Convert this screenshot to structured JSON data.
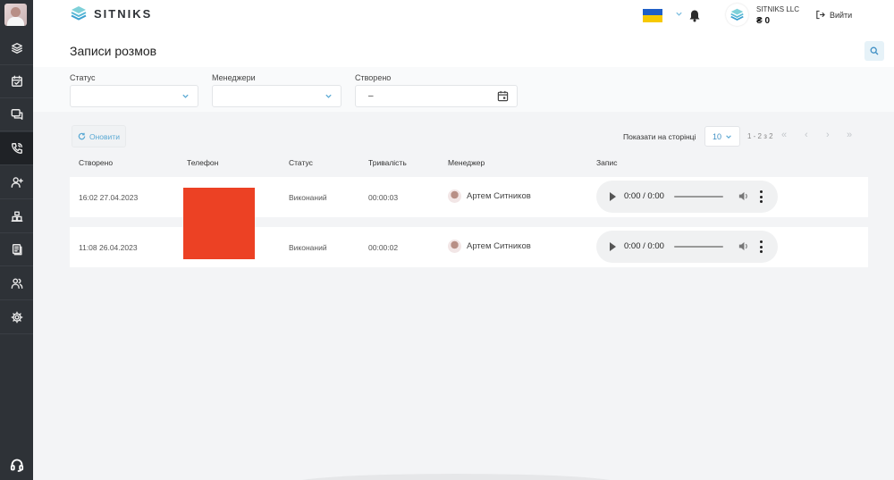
{
  "app": {
    "brand": "SITNIKS",
    "company": "SITNIKS LLC",
    "balance": "₴ 0",
    "logout_label": "Вийти",
    "accent": "#5aa9d4"
  },
  "sidebar": {
    "items": [
      {
        "icon": "layers-icon"
      },
      {
        "icon": "calendar-icon"
      },
      {
        "icon": "chat-icon"
      },
      {
        "icon": "phone-icon",
        "active": true
      },
      {
        "icon": "add-user-icon"
      },
      {
        "icon": "warehouse-icon"
      },
      {
        "icon": "documents-icon"
      },
      {
        "icon": "users-icon"
      },
      {
        "icon": "settings-icon"
      }
    ],
    "bottom_icon": "support-headset-icon"
  },
  "page": {
    "title": "Записи розмов"
  },
  "filters": {
    "status_label": "Статус",
    "status_value": "",
    "managers_label": "Менеджери",
    "managers_value": "",
    "created_label": "Створено",
    "created_value": "–"
  },
  "toolbar": {
    "refresh_label": "Оновити",
    "per_page_label": "Показати на сторінці",
    "per_page_value": "10",
    "page_info": "1 - 2 з 2"
  },
  "table": {
    "columns": [
      "Створено",
      "Телефон",
      "Статус",
      "Тривалість",
      "Менеджер",
      "Запис"
    ],
    "rows": [
      {
        "created": "16:02 27.04.2023",
        "phone": "",
        "status": "Виконаний",
        "duration": "00:00:03",
        "manager": "Артем Ситников",
        "audio_time": "0:00 / 0:00"
      },
      {
        "created": "11:08 26.04.2023",
        "phone": "",
        "status": "Виконаний",
        "duration": "00:00:02",
        "manager": "Артем Ситников",
        "audio_time": "0:00 / 0:00"
      }
    ]
  }
}
